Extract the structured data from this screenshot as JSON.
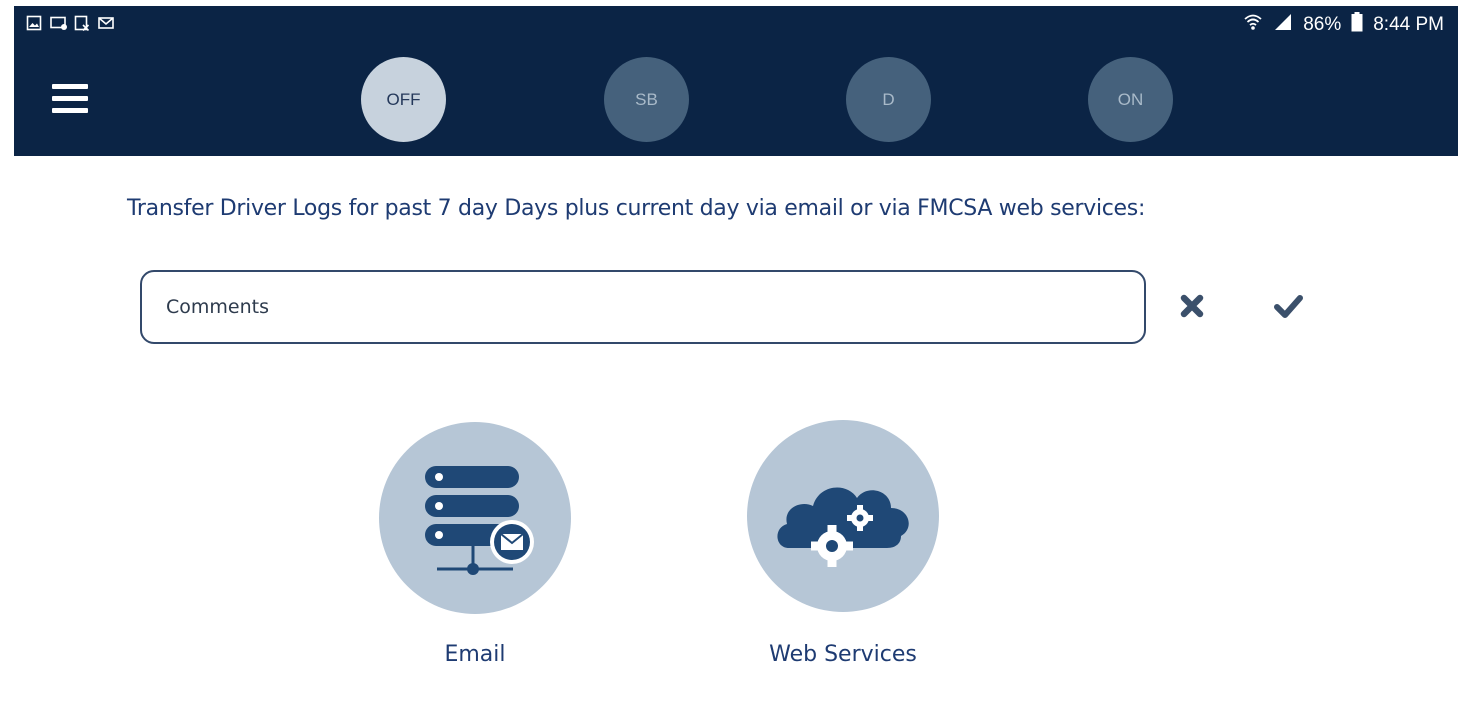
{
  "status_bar": {
    "notification_icons": [
      "image-icon",
      "cast-icon",
      "prescription-icon",
      "mail-icon"
    ],
    "battery_percent": "86%",
    "time": "8:44 PM"
  },
  "nav": {
    "duty_status": [
      {
        "label": "OFF",
        "active": true
      },
      {
        "label": "SB",
        "active": false
      },
      {
        "label": "D",
        "active": false
      },
      {
        "label": "ON",
        "active": false
      }
    ]
  },
  "main": {
    "instruction": "Transfer Driver Logs for past 7 day Days plus current day via email or via FMCSA web services:",
    "comments_placeholder": "Comments",
    "options": [
      {
        "label": "Email",
        "icon": "server-mail-icon"
      },
      {
        "label": "Web Services",
        "icon": "cloud-gears-icon"
      }
    ]
  },
  "colors": {
    "header_bg": "#0b2445",
    "active_circle": "#c7d2dd",
    "inactive_circle": "#45617c",
    "option_circle": "#b6c6d6",
    "text_blue": "#1e3b72",
    "icon_dark": "#1f4876"
  }
}
